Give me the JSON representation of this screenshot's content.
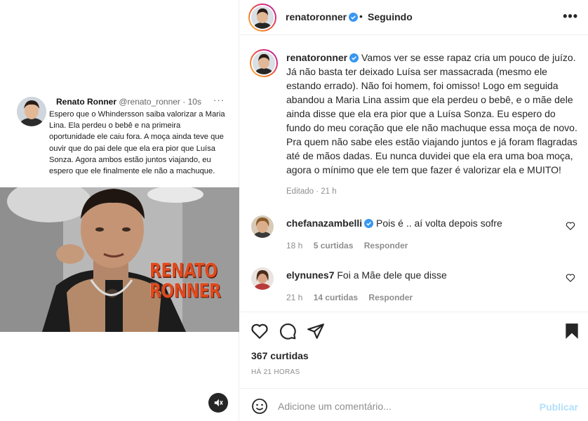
{
  "post": {
    "username": "renatoronner",
    "follow_status": "Seguindo",
    "dot": "•",
    "more": "•••",
    "caption": "Vamos ver se esse rapaz cria um pouco de juízo. Já não basta ter deixado Luísa ser massacrada (mesmo ele estando errado). Não foi homem, foi omisso! Logo em seguida abandou a Maria Lina assim que ela perdeu o bebê, e o mãe dele ainda disse que ela era pior que a Luísa Sonza. Eu espero do fundo do meu coração que ele não machuque essa moça de novo. Pra quem não sabe eles estão viajando juntos e já foram flagradas até de mãos dadas. Eu nunca duvidei que ela era uma boa moça, agora o mínimo que ele tem que fazer é valorizar ela e MUITO!",
    "caption_meta": "Editado · 21 h",
    "likes": "367 curtidas",
    "time": "HÁ 21 HORAS"
  },
  "tweet": {
    "name": "Renato Ronner",
    "handle": "@renato_ronner · 10s",
    "more": "···",
    "text": "Espero que o Whindersson saiba valorizar a Maria Lina. Ela perdeu o bebê e na primeira oportunidade ele caiu fora. A moça ainda teve que ouvir que do pai dele que ela era pior que Luísa Sonza. Agora ambos estão juntos viajando, eu espero que ele finalmente ele não a machuque.",
    "brand_line1": "RENATO",
    "brand_line2": "RONNER"
  },
  "comments": [
    {
      "username": "chefanazambelli",
      "verified": true,
      "text": "Pois é .. aí volta depois sofre",
      "age": "18 h",
      "likes": "5 curtidas",
      "reply": "Responder"
    },
    {
      "username": "elynunes7",
      "verified": false,
      "text": "Foi a Mãe dele que disse",
      "age": "21 h",
      "likes": "14 curtidas",
      "reply": "Responder"
    }
  ],
  "composer": {
    "placeholder": "Adicione um comentário...",
    "publish": "Publicar"
  },
  "icons": {
    "verified": "verified-badge-icon",
    "like": "heart-icon",
    "comment": "comment-icon",
    "share": "send-icon",
    "save": "bookmark-icon",
    "emoji": "emoji-icon",
    "mute": "muted-speaker-icon"
  },
  "colors": {
    "verified_blue": "#3897f0",
    "publish_disabled": "#b2dffc",
    "brand_orange": "#e04a1e"
  }
}
